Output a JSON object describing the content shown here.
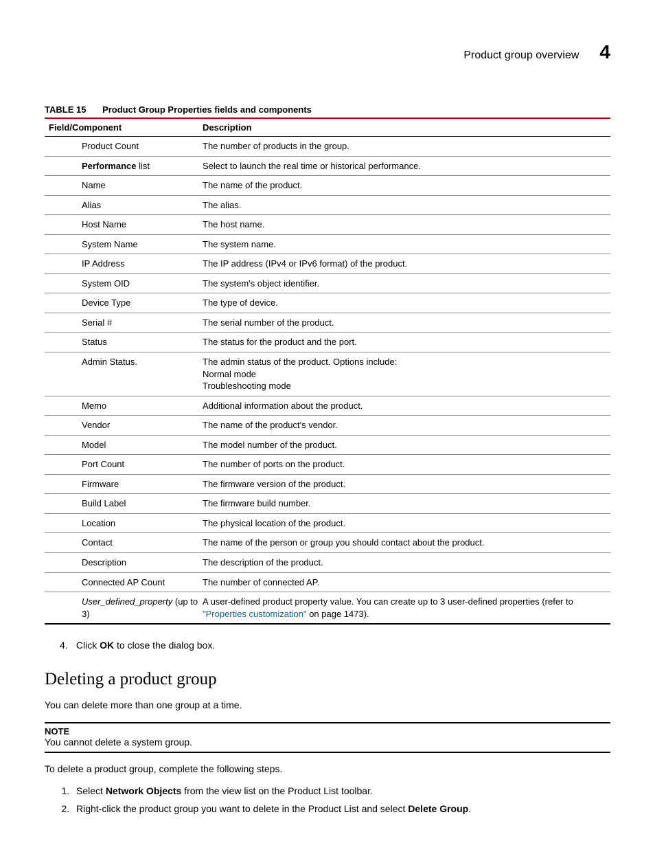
{
  "header": {
    "title": "Product group overview",
    "chapter_number": "4"
  },
  "table": {
    "label": "TABLE 15",
    "caption": "Product Group Properties fields and components",
    "col_field": "Field/Component",
    "col_desc": "Description",
    "rows": [
      {
        "field_html": "Product Count",
        "desc_html": "The number of products in the group."
      },
      {
        "field_html": "<span class='b'>Performance</span> list",
        "desc_html": "Select to launch the real time or historical performance."
      },
      {
        "field_html": "Name",
        "desc_html": "The name of the product."
      },
      {
        "field_html": "Alias",
        "desc_html": "The alias."
      },
      {
        "field_html": "Host Name",
        "desc_html": "The host name."
      },
      {
        "field_html": "System Name",
        "desc_html": "The system name."
      },
      {
        "field_html": "IP Address",
        "desc_html": "The IP address (IPv4 or IPv6 format) of the product."
      },
      {
        "field_html": "System OID",
        "desc_html": "The system's object identifier."
      },
      {
        "field_html": "Device Type",
        "desc_html": "The type of device."
      },
      {
        "field_html": "Serial #",
        "desc_html": "The serial number of the product."
      },
      {
        "field_html": "Status",
        "desc_html": "The status for the product and the port."
      },
      {
        "field_html": "Admin Status.",
        "desc_html": "The admin status of the product. Options include:<br>Normal mode<br>Troubleshooting mode"
      },
      {
        "field_html": "Memo",
        "desc_html": "Additional information about the product."
      },
      {
        "field_html": "Vendor",
        "desc_html": "The name of the product's vendor."
      },
      {
        "field_html": "Model",
        "desc_html": "The model number of the product."
      },
      {
        "field_html": "Port Count",
        "desc_html": "The number of ports on the product."
      },
      {
        "field_html": "Firmware",
        "desc_html": "The firmware version of the product."
      },
      {
        "field_html": "Build Label",
        "desc_html": "The firmware build number."
      },
      {
        "field_html": "Location",
        "desc_html": "The physical location of the product."
      },
      {
        "field_html": "Contact",
        "desc_html": "The name of the person or group you should contact about the product."
      },
      {
        "field_html": "Description",
        "desc_html": "The description of the product."
      },
      {
        "field_html": "Connected AP Count",
        "desc_html": "The number of connected AP."
      },
      {
        "field_html": "<span class='i'>User_defined_property</span> (up to 3)",
        "desc_html": "A user-defined product property value. You can create up to 3 user-defined properties (refer to <span class='link'>\"Properties customization\"</span> on page 1473)."
      }
    ]
  },
  "step4": {
    "num": "4.",
    "text_html": "Click <span class='b'>OK</span> to close the dialog box."
  },
  "section": {
    "heading": "Deleting a product group",
    "intro": "You can delete more than one group at a time.",
    "note_label": "NOTE",
    "note_text": "You cannot delete a system group.",
    "lead": "To delete a product group, complete the following steps.",
    "steps": [
      "Select <span class='b'>Network Objects</span> from the view list on the Product List toolbar.",
      "Right-click the product group you want to delete in the Product List and select <span class='b'>Delete Group</span>."
    ]
  }
}
